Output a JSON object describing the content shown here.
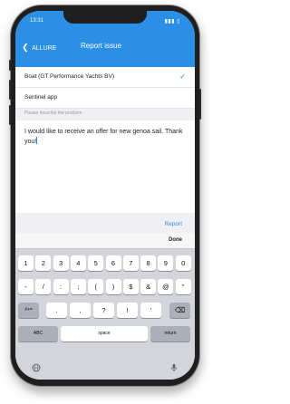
{
  "status": {
    "time": "13:31",
    "right": "▮▮▮ ▯"
  },
  "nav": {
    "back_label": "ALLURE",
    "title": "Report issue"
  },
  "options": [
    {
      "label": "Boat (GT Performance Yachts BV)",
      "selected": true
    },
    {
      "label": "Sentinel app",
      "selected": false
    }
  ],
  "problem": {
    "hint": "Please describe the problem",
    "text": "I would like to receive an offer for new genoa sail. Thank you!"
  },
  "report_label": "Report",
  "keyboard": {
    "done_label": "Done",
    "row1": [
      "1",
      "2",
      "3",
      "4",
      "5",
      "6",
      "7",
      "8",
      "9",
      "0"
    ],
    "row2": [
      "-",
      "/",
      ":",
      ";",
      "(",
      ")",
      "$",
      "&",
      "@",
      "\""
    ],
    "row3_left": "#+=",
    "row3": [
      ".",
      ",",
      "?",
      "!",
      "'"
    ],
    "row4_left": "ABC",
    "space_label": "space",
    "return_label": "return"
  },
  "colors": {
    "accent": "#2b8fe5",
    "keyboard_bg": "#d3d5db"
  }
}
